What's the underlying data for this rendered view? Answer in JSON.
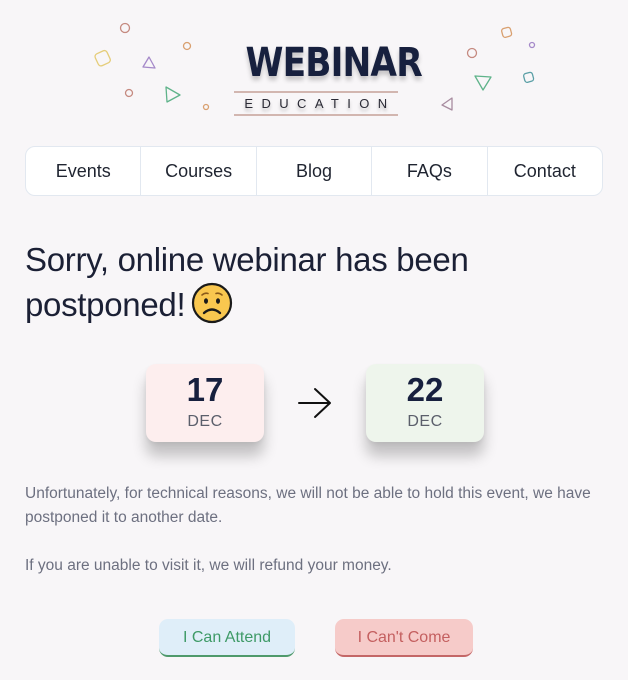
{
  "logo": {
    "title": "WEBINAR",
    "subtitle": "EDUCATION"
  },
  "decorations": {
    "colors": {
      "orange": "#d9a070",
      "brown": "#c58a80",
      "yellow": "#e5cd7a",
      "purple": "#a589c9",
      "green": "#5fb38a",
      "teal": "#5a9fa6",
      "mauve": "#a88ca0"
    }
  },
  "nav": {
    "items": [
      {
        "label": "Events"
      },
      {
        "label": "Courses"
      },
      {
        "label": "Blog"
      },
      {
        "label": "FAQs"
      },
      {
        "label": "Contact"
      }
    ]
  },
  "headline": {
    "text": "Sorry, online webinar has been postponed!",
    "emoji": "worried-face-icon"
  },
  "dates": {
    "old": {
      "day": "17",
      "month": "DEC",
      "bg": "#fdeeee"
    },
    "new": {
      "day": "22",
      "month": "DEC",
      "bg": "#eef5ec"
    },
    "arrow": "right-arrow-icon"
  },
  "body": {
    "paragraph1": "Unfortunately, for technical reasons, we will not be able to hold this event, we have postponed it to another date.",
    "paragraph2": "If you are unable to visit it, we will refund your money."
  },
  "buttons": {
    "attend": {
      "label": "I Can Attend",
      "color": "#3e9a67",
      "bg": "#dfeef9"
    },
    "cant": {
      "label": "I Can't Come",
      "color": "#c46060",
      "bg": "#f6cbc9"
    }
  }
}
